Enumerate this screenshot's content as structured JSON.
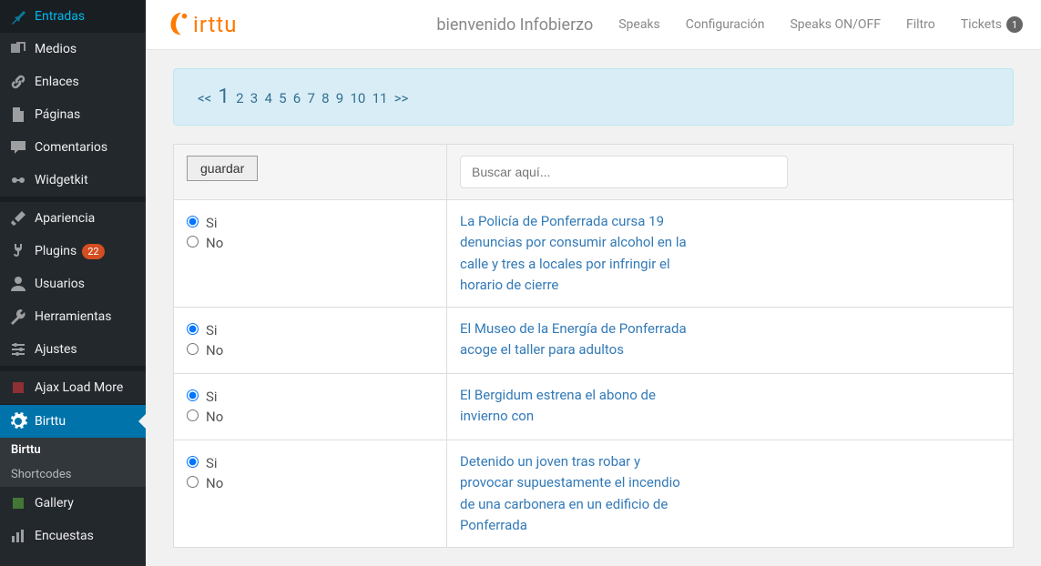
{
  "sidebar": {
    "items": [
      {
        "label": "Entradas",
        "icon": "pin"
      },
      {
        "label": "Medios",
        "icon": "media"
      },
      {
        "label": "Enlaces",
        "icon": "link"
      },
      {
        "label": "Páginas",
        "icon": "page"
      },
      {
        "label": "Comentarios",
        "icon": "comment"
      },
      {
        "label": "Widgetkit",
        "icon": "widget"
      },
      {
        "label": "Apariencia",
        "icon": "brush"
      },
      {
        "label": "Plugins",
        "icon": "plug",
        "badge": "22"
      },
      {
        "label": "Usuarios",
        "icon": "user"
      },
      {
        "label": "Herramientas",
        "icon": "wrench"
      },
      {
        "label": "Ajustes",
        "icon": "sliders"
      },
      {
        "label": "Ajax Load More",
        "icon": "red"
      },
      {
        "label": "Birttu",
        "icon": "gear",
        "active": true
      },
      {
        "label": "Gallery",
        "icon": "green"
      },
      {
        "label": "Encuestas",
        "icon": "bars"
      }
    ],
    "submenu": [
      {
        "label": "Birttu",
        "current": true
      },
      {
        "label": "Shortcodes"
      }
    ]
  },
  "logo_text": "irttu",
  "welcome": "bienvenido Infobierzo",
  "topnav": [
    {
      "label": "Speaks"
    },
    {
      "label": "Configuración"
    },
    {
      "label": "Speaks ON/OFF"
    },
    {
      "label": "Filtro"
    },
    {
      "label": "Tickets",
      "count": "1"
    }
  ],
  "pager": {
    "prev": "<<",
    "current": "1",
    "pages": [
      "2",
      "3",
      "4",
      "5",
      "6",
      "7",
      "8",
      "9",
      "10",
      "11"
    ],
    "next": ">>"
  },
  "save_label": "guardar",
  "search_placeholder": "Buscar aquí...",
  "option_yes": "Si",
  "option_no": "No",
  "rows": [
    {
      "selected": "si",
      "title": "La Policía de Ponferrada cursa 19 denuncias por consumir alcohol en la calle y tres a locales por infringir el horario de cierre"
    },
    {
      "selected": "si",
      "title": "El Museo de la Energía de Ponferrada acoge el taller para adultos"
    },
    {
      "selected": "si",
      "title": "El Bergidum estrena el abono de invierno con"
    },
    {
      "selected": "si",
      "title": "Detenido un joven tras robar y provocar supuestamente el incendio de una carbonera en un edificio de Ponferrada"
    }
  ]
}
